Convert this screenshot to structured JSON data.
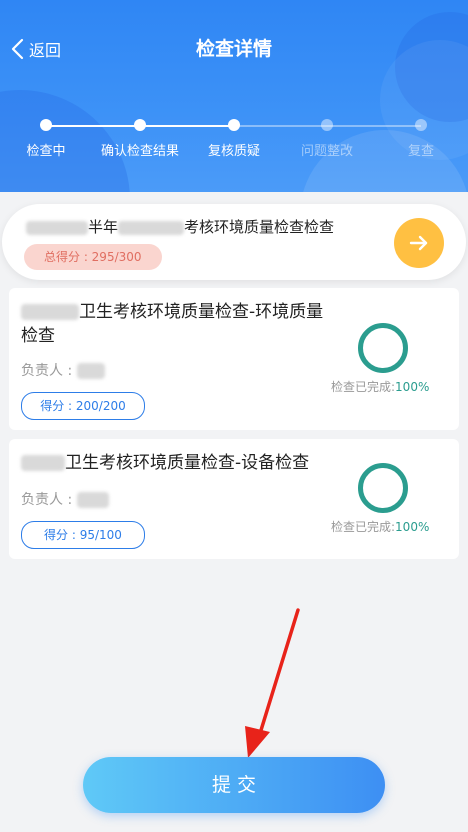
{
  "header": {
    "back_label": "返回",
    "title": "检查详情",
    "steps": [
      {
        "label": "检查中",
        "active": true
      },
      {
        "label": "确认检查结果",
        "active": true
      },
      {
        "label": "复核质疑",
        "active": true
      },
      {
        "label": "问题整改",
        "active": false
      },
      {
        "label": "复查",
        "active": false
      }
    ]
  },
  "summary": {
    "title_part1": "半年",
    "title_part2": "考核环境质量检查检查",
    "total_score": "总得分 : 295/300"
  },
  "items": [
    {
      "title_line1": "卫生考核环境质量检查-环境质量",
      "title_line2": "检查",
      "owner_label": "负责人 :",
      "score": "得分 : 200/200",
      "progress_label": "检查已完成:",
      "progress_value": "100%"
    },
    {
      "title_line1": "卫生考核环境质量检查-设备检查",
      "owner_label": "负责人 :",
      "score": "得分 : 95/100",
      "progress_label": "检查已完成:",
      "progress_value": "100%"
    }
  ],
  "submit_label": "提 交",
  "colors": {
    "primary": "#2f86f4",
    "accent_yellow": "#ffc042",
    "ring_teal": "#2b9d8f",
    "badge_bg": "#fad5cf",
    "badge_text": "#e06e61"
  }
}
